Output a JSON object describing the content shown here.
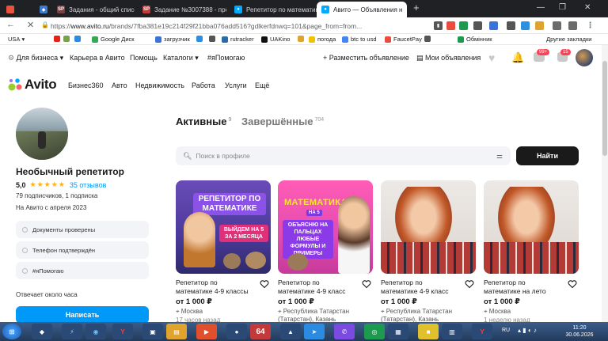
{
  "browser": {
    "tabs": [
      {
        "title": "",
        "icon": "app-icon"
      },
      {
        "title": "",
        "icon": "vk-icon"
      },
      {
        "title": "Задания - общий список",
        "icon": "sp-icon"
      },
      {
        "title": "Задание №3007388 - про",
        "icon": "sp-icon"
      },
      {
        "title": "Репетитор по математике",
        "icon": "avito-icon"
      },
      {
        "title": "Авито — Объявления н",
        "icon": "avito-icon"
      }
    ],
    "url_prefix": "https://",
    "url_domain": "www.avito.ru",
    "url_path": "/brands/7fba381e19c214f29f21bba076add516?gdlkerfdnwq=101&page_from=from...",
    "bookmarks": [
      "USA",
      "Google Диск",
      "загрузчик",
      "rutracker",
      "UAKino",
      "погода",
      "btc to usd",
      "FaucetPay",
      "Обмінник",
      "Другие закладки"
    ]
  },
  "site": {
    "top_links": [
      "Для бизнеса",
      "Карьера в Авито",
      "Помощь",
      "Каталоги",
      "#яПомогаю"
    ],
    "post_ad": "Разместить объявление",
    "my_ads": "Мои объявления",
    "badge_messages": "99+",
    "badge_cart": "15",
    "logo": "Avito",
    "main_nav": [
      "Бизнес360",
      "Авто",
      "Недвижимость",
      "Работа",
      "Услуги",
      "Ещё"
    ]
  },
  "profile": {
    "name": "Необычный репетитор",
    "rating": "5,0",
    "stars": 5,
    "reviews": "35 отзывов",
    "followers": "79 подписчиков, 1 подписка",
    "since": "На Авито с апреля 2023",
    "badges": [
      "Документы проверены",
      "Телефон подтверждён",
      "#яПомогаю"
    ],
    "response": "Отвечает около часа",
    "contact_button": "Написать"
  },
  "listing": {
    "tab_active": "Активные",
    "tab_active_count": "9",
    "tab_done": "Завершённые",
    "tab_done_count": "704",
    "search_placeholder": "Поиск в профиле",
    "search_button": "Найти",
    "items": [
      {
        "title": "Репетитор по математике 4-9 классы",
        "price": "от 1 000 ₽",
        "location": "Москва",
        "time": "17 часов назад",
        "thumb_title": "РЕПЕТИТОР ПО МАТЕМАТИКЕ",
        "thumb_sub": "ВЫЙДЕМ НА 5 ЗА 2 МЕСЯЦА"
      },
      {
        "title": "Репетитор по математике 4-9 класс",
        "price": "от 1 000 ₽",
        "location": "Республика Татарстан (Татарстан), Казань",
        "time": "",
        "thumb_title": "МАТЕМАТИКА",
        "thumb_tag": "НА 5",
        "thumb_sub": "ОБЪЯСНЮ НА ПАЛЬЦАХ ЛЮБЫЕ ФОРМУЛЫ И ПРИМЕРЫ"
      },
      {
        "title": "Репетитор по математике 4-9 класс",
        "price": "от 1 000 ₽",
        "location": "Республика Татарстан (Татарстан), Казань",
        "time": ""
      },
      {
        "title": "Репетитор по математике на лето",
        "price": "от 1 000 ₽",
        "location": "Москва",
        "time": "1 неделю назад"
      }
    ]
  },
  "taskbar": {
    "lang": "RU",
    "time": "11:20",
    "date": "30.06.2026"
  },
  "colors": {
    "avito_blue": "#0099f7",
    "dark_button": "#1a1a1a",
    "tabbar": "#1f2125",
    "star": "#ffb021"
  }
}
